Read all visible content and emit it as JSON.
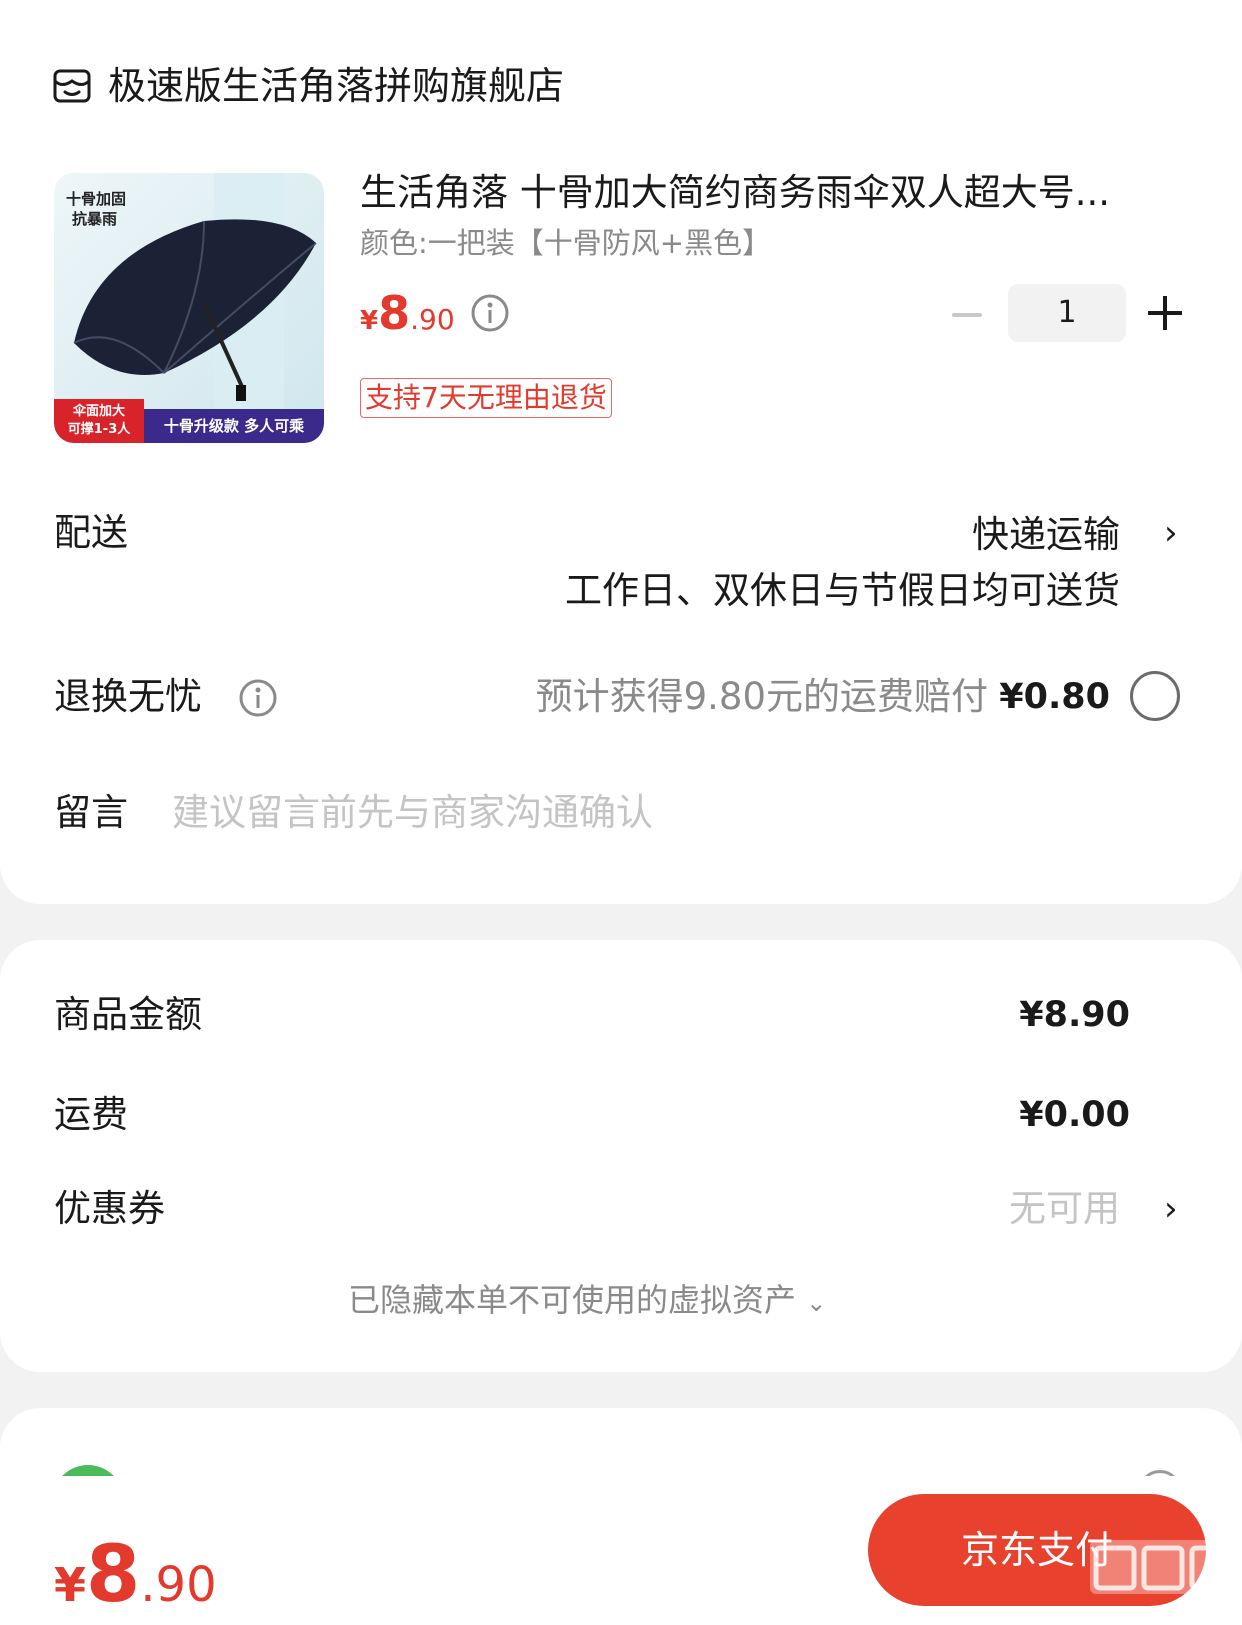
{
  "store": {
    "name": "极速版生活角落拼购旗舰店",
    "icon": "store-icon"
  },
  "product": {
    "title": "生活角落 十骨加大简约商务雨伞双人超大号...",
    "spec": "颜色:一把装【十骨防风+黑色】",
    "price_currency": "¥",
    "price_int": "8",
    "price_dec": ".90",
    "return_tag": "支持7天无理由退货",
    "quantity": "1",
    "image": {
      "tag_line1": "十骨加固",
      "tag_line2": "抗暴雨",
      "badge_red_line1": "伞面加大",
      "badge_red_line2": "可撑1-3人",
      "badge_blue": "十骨升级款 多人可乘"
    }
  },
  "delivery": {
    "label": "配送",
    "method": "快递运输",
    "note": "工作日、双休日与节假日均可送货"
  },
  "return_insurance": {
    "label": "退换无忧",
    "desc": "预计获得9.80元的运费赔付",
    "price": "¥0.80"
  },
  "message": {
    "label": "留言",
    "placeholder": "建议留言前先与商家沟通确认"
  },
  "summary": {
    "goods_label": "商品金额",
    "goods_value": "¥8.90",
    "shipping_label": "运费",
    "shipping_value": "¥0.00",
    "coupon_label": "优惠券",
    "coupon_value": "无可用",
    "hidden_assets": "已隐藏本单不可使用的虚拟资产"
  },
  "footer": {
    "total_currency": "¥",
    "total_int": "8",
    "total_dec": ".90",
    "pay_button": "京东支付"
  },
  "colors": {
    "accent_red": "#e43a2e",
    "pay_button": "#e8412d",
    "pay_icon_green": "#4cbb5a"
  }
}
